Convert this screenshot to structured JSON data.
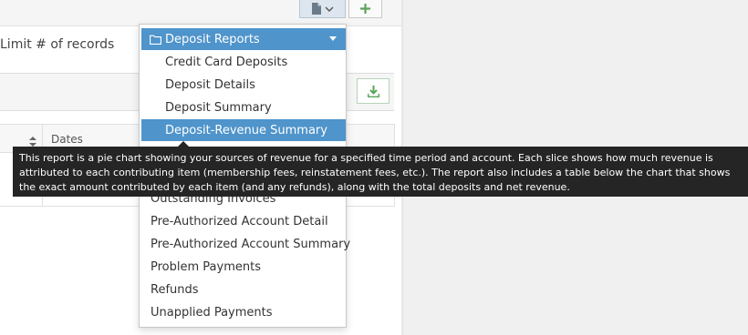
{
  "filter": {
    "limit_label": "Limit # of records"
  },
  "grid": {
    "dates_header": "Dates"
  },
  "dropdown": {
    "group_label": "Deposit Reports",
    "sub_items": [
      "Credit Card Deposits",
      "Deposit Details",
      "Deposit Summary",
      "Deposit-Revenue Summary"
    ],
    "top_items": [
      "Outstanding Invoices",
      "Pre-Authorized Account Detail",
      "Pre-Authorized Account Summary",
      "Problem Payments",
      "Refunds",
      "Unapplied Payments"
    ]
  },
  "tooltip": {
    "text": "This report is a pie chart showing your sources of revenue for a specified time period and account. Each slice shows how much revenue is attributed to each contributing item (membership fees, reinstatement fees, etc.). The report also includes a table below the chart that shows the exact amount contributed by each item (and any refunds), along with the total deposits and net revenue."
  },
  "colors": {
    "highlight": "#4f94cb",
    "tooltip_bg": "#252525",
    "add_green": "#5aa55a"
  },
  "icons": {
    "report_button": "document-icon",
    "report_caret": "chevron-down-icon",
    "add_button": "plus-icon",
    "download_button": "download-icon",
    "sort": "sort-icon",
    "group": "folder-icon"
  }
}
